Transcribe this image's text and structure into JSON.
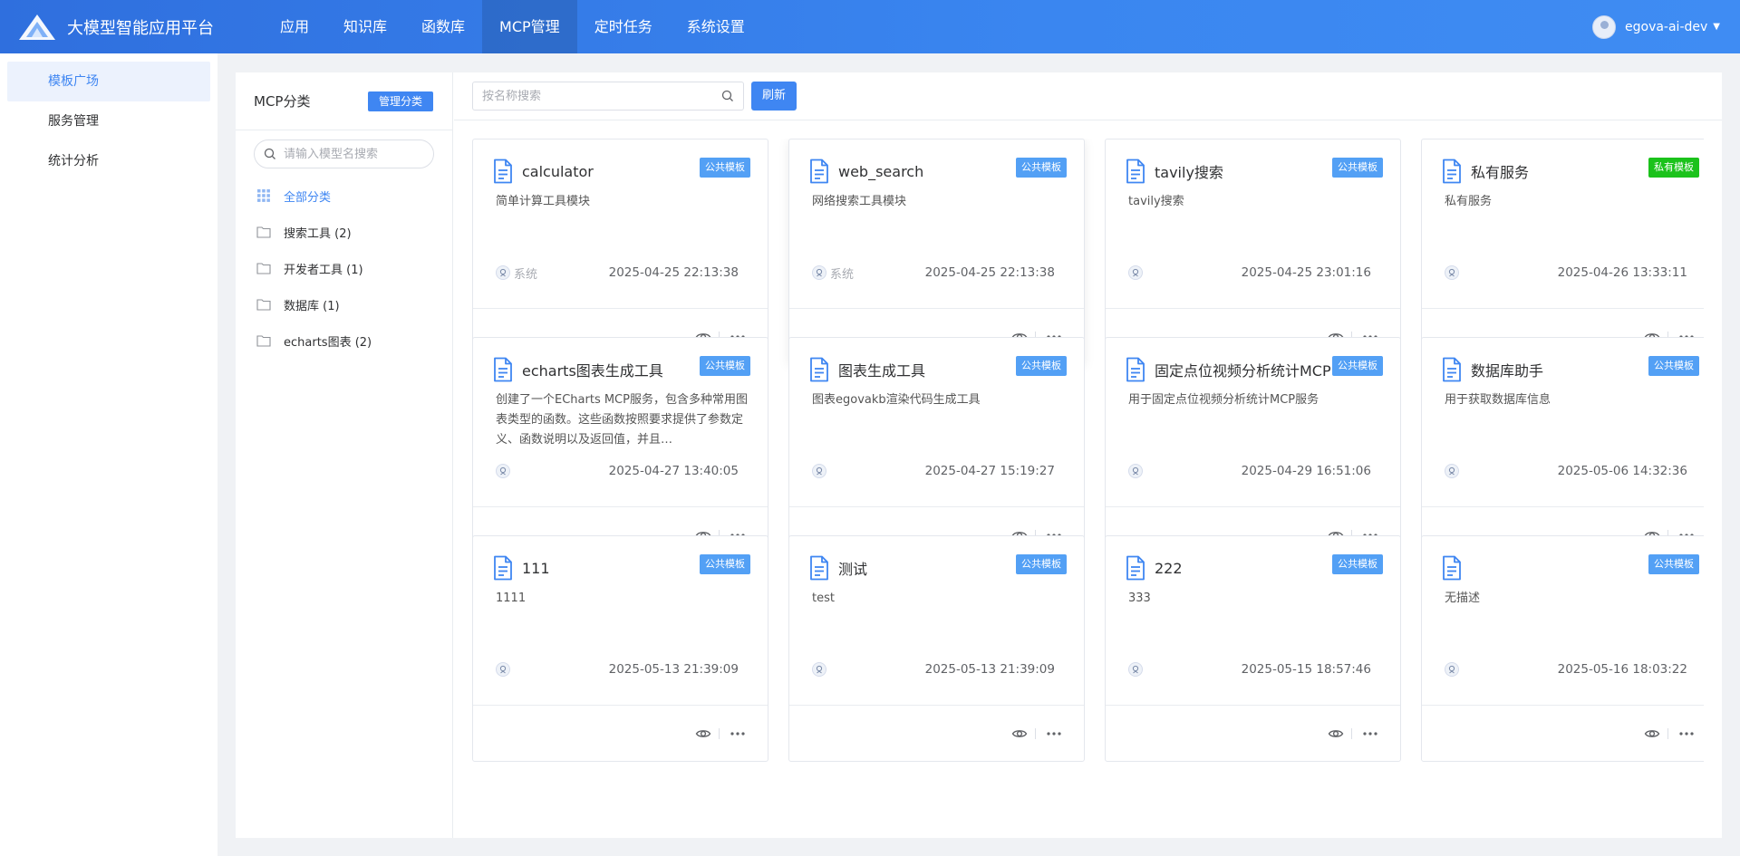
{
  "app": {
    "title": "大模型智能应用平台"
  },
  "nav": {
    "items": [
      {
        "label": "应用"
      },
      {
        "label": "知识库"
      },
      {
        "label": "函数库"
      },
      {
        "label": "MCP管理",
        "active": true
      },
      {
        "label": "定时任务"
      },
      {
        "label": "系统设置"
      }
    ]
  },
  "user": {
    "name": "egova-ai-dev"
  },
  "sidebar": {
    "items": [
      {
        "label": "模板广场",
        "active": true
      },
      {
        "label": "服务管理"
      },
      {
        "label": "统计分析"
      }
    ]
  },
  "categories": {
    "title": "MCP分类",
    "manage_label": "管理分类",
    "search_placeholder": "请输入模型名搜索",
    "items": [
      {
        "label": "全部分类",
        "icon": "grid-icon",
        "active": true
      },
      {
        "label": "搜索工具 (2)",
        "icon": "folder-icon"
      },
      {
        "label": "开发者工具 (1)",
        "icon": "folder-icon"
      },
      {
        "label": "数据库 (1)",
        "icon": "folder-icon"
      },
      {
        "label": "echarts图表 (2)",
        "icon": "folder-icon"
      }
    ]
  },
  "toolbar": {
    "search_placeholder": "按名称搜索",
    "refresh_label": "刷新"
  },
  "colors": {
    "primary": "#3f86f2",
    "public_badge": "#53a0f5",
    "private_badge": "#1bc21b"
  },
  "cards": [
    {
      "title": "calculator",
      "badge": "公共模板",
      "badge_type": "public",
      "desc": "简单计算工具模块",
      "owner": "系统",
      "date": "2025-04-25 22:13:38"
    },
    {
      "title": "web_search",
      "badge": "公共模板",
      "badge_type": "public",
      "desc": "网络搜索工具模块",
      "owner": "系统",
      "date": "2025-04-25 22:13:38"
    },
    {
      "title": "tavily搜索",
      "badge": "公共模板",
      "badge_type": "public",
      "desc": "tavily搜索",
      "owner": "",
      "date": "2025-04-25 23:01:16"
    },
    {
      "title": "私有服务",
      "badge": "私有模板",
      "badge_type": "private",
      "desc": "私有服务",
      "owner": "",
      "date": "2025-04-26 13:33:11"
    },
    {
      "title": "echarts图表生成工具",
      "badge": "公共模板",
      "badge_type": "public",
      "desc": "创建了一个ECharts MCP服务，包含多种常用图表类型的函数。这些函数按照要求提供了参数定义、函数说明以及返回值，并且…",
      "owner": "",
      "date": "2025-04-27 13:40:05"
    },
    {
      "title": "图表生成工具",
      "badge": "公共模板",
      "badge_type": "public",
      "desc": "图表egovakb渲染代码生成工具",
      "owner": "",
      "date": "2025-04-27 15:19:27"
    },
    {
      "title": "固定点位视频分析统计MCP",
      "badge": "公共模板",
      "badge_type": "public",
      "desc": "用于固定点位视频分析统计MCP服务",
      "owner": "",
      "date": "2025-04-29 16:51:06"
    },
    {
      "title": "数据库助手",
      "badge": "公共模板",
      "badge_type": "public",
      "desc": "用于获取数据库信息",
      "owner": "",
      "date": "2025-05-06 14:32:36"
    },
    {
      "title": "111",
      "badge": "公共模板",
      "badge_type": "public",
      "desc": "1111",
      "owner": "",
      "date": "2025-05-13 21:39:09"
    },
    {
      "title": "测试",
      "badge": "公共模板",
      "badge_type": "public",
      "desc": "test",
      "owner": "",
      "date": "2025-05-13 21:39:09"
    },
    {
      "title": "222",
      "badge": "公共模板",
      "badge_type": "public",
      "desc": "333",
      "owner": "",
      "date": "2025-05-15 18:57:46"
    },
    {
      "title": "",
      "badge": "公共模板",
      "badge_type": "public",
      "desc": "无描述",
      "owner": "",
      "date": "2025-05-16 18:03:22"
    }
  ]
}
